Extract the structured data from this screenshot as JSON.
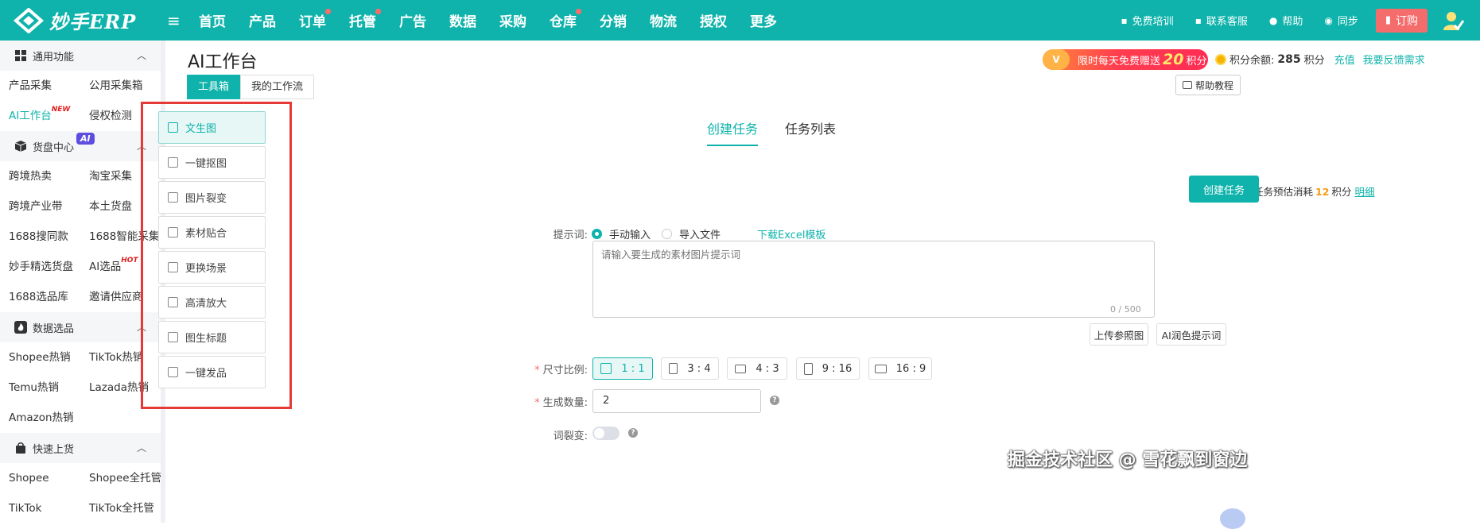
{
  "app": {
    "logo_text": "妙手ERP"
  },
  "nav": {
    "items": [
      {
        "label": "首页",
        "dot": false
      },
      {
        "label": "产品",
        "dot": false
      },
      {
        "label": "订单",
        "dot": true
      },
      {
        "label": "托管",
        "dot": true
      },
      {
        "label": "广告",
        "dot": false
      },
      {
        "label": "数据",
        "dot": false
      },
      {
        "label": "采购",
        "dot": false
      },
      {
        "label": "仓库",
        "dot": true
      },
      {
        "label": "分销",
        "dot": false
      },
      {
        "label": "物流",
        "dot": false
      },
      {
        "label": "授权",
        "dot": false
      },
      {
        "label": "更多",
        "dot": false
      }
    ],
    "right": {
      "training": "免费培训",
      "service": "联系客服",
      "help": "帮助",
      "sync": "同步",
      "order": "订购"
    }
  },
  "sidebar": {
    "sections": [
      {
        "title": "通用功能",
        "icon": "grid-icon",
        "badge": "",
        "links": [
          {
            "label": "产品采集",
            "sup": ""
          },
          {
            "label": "公用采集箱",
            "sup": ""
          },
          {
            "label": "AI工作台",
            "sup": "NEW",
            "active": true
          },
          {
            "label": "侵权检测",
            "sup": ""
          }
        ]
      },
      {
        "title": "货盘中心",
        "icon": "box-icon",
        "badge": "AI",
        "links": [
          {
            "label": "跨境热卖",
            "sup": ""
          },
          {
            "label": "淘宝采集",
            "sup": ""
          },
          {
            "label": "跨境产业带",
            "sup": ""
          },
          {
            "label": "本土货盘",
            "sup": ""
          },
          {
            "label": "1688搜同款",
            "sup": ""
          },
          {
            "label": "1688智能采集",
            "sup": ""
          },
          {
            "label": "妙手精选货盘",
            "sup": ""
          },
          {
            "label": "AI选品",
            "sup": "HOT"
          },
          {
            "label": "1688选品库",
            "sup": ""
          },
          {
            "label": "邀请供应商",
            "sup": ""
          }
        ]
      },
      {
        "title": "数据选品",
        "icon": "fire-icon",
        "badge": "",
        "links": [
          {
            "label": "Shopee热销",
            "sup": ""
          },
          {
            "label": "TikTok热销",
            "sup": ""
          },
          {
            "label": "Temu热销",
            "sup": ""
          },
          {
            "label": "Lazada热销",
            "sup": ""
          },
          {
            "label": "Amazon热销",
            "sup": ""
          }
        ]
      },
      {
        "title": "快速上货",
        "icon": "bag-icon",
        "badge": "",
        "links": [
          {
            "label": "Shopee",
            "sup": ""
          },
          {
            "label": "Shopee全托管",
            "sup": ""
          },
          {
            "label": "TikTok",
            "sup": ""
          },
          {
            "label": "TikTok全托管",
            "sup": ""
          }
        ]
      }
    ]
  },
  "page": {
    "title": "AI工作台",
    "promo": {
      "prefix": "限时每天免费赠送",
      "number": "20",
      "suffix": "积分"
    },
    "points": {
      "label": "积分余额:",
      "value": "285",
      "unit": "积分",
      "recharge": "充值",
      "feedback": "我要反馈需求"
    },
    "tabs": [
      {
        "label": "工具箱",
        "active": true
      },
      {
        "label": "我的工作流",
        "active": false
      }
    ],
    "help_tutorial": "帮助教程"
  },
  "toolbox": [
    {
      "label": "文生图",
      "icon": "text-to-image-icon",
      "active": true
    },
    {
      "label": "一键抠图",
      "icon": "cutout-icon",
      "active": false
    },
    {
      "label": "图片裂变",
      "icon": "image-variation-icon",
      "active": false
    },
    {
      "label": "素材贴合",
      "icon": "material-fit-icon",
      "active": false
    },
    {
      "label": "更换场景",
      "icon": "scene-swap-icon",
      "active": false
    },
    {
      "label": "高清放大",
      "icon": "upscale-icon",
      "active": false
    },
    {
      "label": "图生标题",
      "icon": "image-title-icon",
      "active": false
    },
    {
      "label": "一键发品",
      "icon": "publish-icon",
      "active": false
    }
  ],
  "task": {
    "tabs": [
      {
        "label": "创建任务",
        "active": true
      },
      {
        "label": "任务列表",
        "active": false
      }
    ],
    "estimate": {
      "prefix": "本次任务预估消耗",
      "value": "12",
      "unit": "积分",
      "detail": "明细"
    },
    "create_button": "创建任务",
    "prompt_label": "提示词:",
    "radio_manual": "手动输入",
    "radio_import": "导入文件",
    "download_template": "下载Excel模板",
    "prompt_placeholder": "请输入要生成的素材图片提示词",
    "prompt_count": "0 / 500",
    "upload_ref": "上传参照图",
    "ai_polish": "AI润色提示词",
    "ratio_label": "尺寸比例:",
    "ratios": [
      {
        "label": "1 : 1",
        "active": true
      },
      {
        "label": "3 : 4",
        "active": false
      },
      {
        "label": "4 : 3",
        "active": false
      },
      {
        "label": "9 : 16",
        "active": false
      },
      {
        "label": "16 : 9",
        "active": false
      }
    ],
    "quantity_label": "生成数量:",
    "quantity_value": "2",
    "variation_label": "词裂变:",
    "variation_on": false
  },
  "watermark": "掘金技术社区 @ 雪花飘到窗边",
  "colors": {
    "brand": "#0fb3ab",
    "highlight_frame": "#e53935",
    "order_button": "#f56c6c"
  }
}
